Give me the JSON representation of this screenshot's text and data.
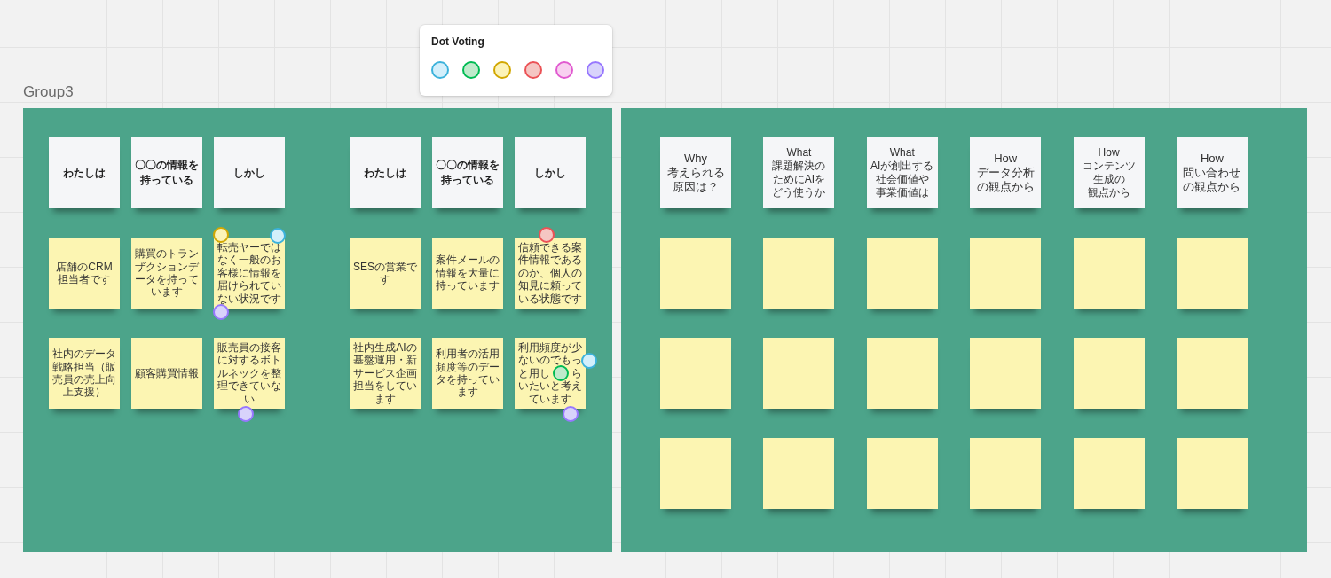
{
  "dot_voting": {
    "title": "Dot Voting",
    "dots": [
      {
        "color": "#d3effb"
      },
      {
        "color": "#bfeacb"
      },
      {
        "color": "#fcf3b8"
      },
      {
        "color": "#f5c6c3"
      },
      {
        "color": "#f8d0f0"
      },
      {
        "color": "#d8d3fb"
      }
    ]
  },
  "boards": [
    {
      "title": "Group3",
      "groups": [
        {
          "columns": [
            {
              "notes": [
                {
                  "kind": "label",
                  "text": "わたしは"
                },
                {
                  "kind": "idea",
                  "text": "店舗のCRM担当者です"
                },
                {
                  "kind": "idea",
                  "text": "社内のデータ戦略担当（販売員の売上向上支援）"
                }
              ]
            },
            {
              "notes": [
                {
                  "kind": "label",
                  "text": "〇〇の情報を持っている"
                },
                {
                  "kind": "idea",
                  "text": "購買のトランザクションデータを持っています"
                },
                {
                  "kind": "idea",
                  "text": "顧客購買情報"
                }
              ]
            },
            {
              "notes": [
                {
                  "kind": "label",
                  "text": "しかし"
                },
                {
                  "kind": "idea",
                  "text": "転売ヤーではなく一般のお客様に情報を届けられていない状況です",
                  "votes": [
                    {
                      "color": "#fcf3b8",
                      "kind": "top-left"
                    },
                    {
                      "color": "#d3effb",
                      "kind": "top-right"
                    },
                    {
                      "color": "#d8d3fb",
                      "kind": "bottom-left"
                    }
                  ]
                },
                {
                  "kind": "idea",
                  "text": "販売員の接客に対するボトルネックを整理できていない",
                  "votes": [
                    {
                      "color": "#d8d3fb",
                      "kind": "bottom"
                    }
                  ]
                }
              ]
            }
          ]
        },
        {
          "columns": [
            {
              "notes": [
                {
                  "kind": "label",
                  "text": "わたしは"
                },
                {
                  "kind": "idea",
                  "text": "SESの営業です"
                },
                {
                  "kind": "idea",
                  "text": "社内生成AIの基盤運用・新サービス企画担当をしています"
                }
              ]
            },
            {
              "notes": [
                {
                  "kind": "label",
                  "text": "〇〇の情報を持っている"
                },
                {
                  "kind": "idea",
                  "text": "案件メールの情報を大量に持っています"
                },
                {
                  "kind": "idea",
                  "text": "利用者の活用頻度等のデータを持っています"
                }
              ]
            },
            {
              "notes": [
                {
                  "kind": "label",
                  "text": "しかし"
                },
                {
                  "kind": "idea",
                  "text": "信頼できる案件情報であるのか、個人の知見に頼っている状態です",
                  "votes": [
                    {
                      "color": "#f5c6c3",
                      "kind": "top"
                    }
                  ]
                },
                {
                  "kind": "idea",
                  "text": "利用頻度が少ないのでもっと用し　　らいたいと考えています",
                  "votes": [
                    {
                      "color": "#d3effb",
                      "kind": "right"
                    },
                    {
                      "color": "#bfeacb",
                      "kind": "center"
                    },
                    {
                      "color": "#d8d3fb",
                      "kind": "bottom-right"
                    }
                  ]
                }
              ]
            }
          ]
        }
      ]
    },
    {
      "groups": [
        {
          "columns": [
            {
              "notes": [
                {
                  "kind": "question",
                  "lines": [
                    "Why",
                    "考えられる",
                    "原因は？"
                  ]
                },
                {
                  "kind": "idea"
                },
                {
                  "kind": "idea"
                },
                {
                  "kind": "idea"
                }
              ]
            },
            {
              "notes": [
                {
                  "kind": "question",
                  "lines": [
                    "What",
                    "課題解決の",
                    "ためにAIを",
                    "どう使うか"
                  ]
                },
                {
                  "kind": "idea"
                },
                {
                  "kind": "idea"
                },
                {
                  "kind": "idea"
                }
              ]
            },
            {
              "notes": [
                {
                  "kind": "question",
                  "lines": [
                    "What",
                    "AIが創出する",
                    "社会価値や",
                    "事業価値は"
                  ]
                },
                {
                  "kind": "idea"
                },
                {
                  "kind": "idea"
                },
                {
                  "kind": "idea"
                }
              ]
            },
            {
              "notes": [
                {
                  "kind": "question",
                  "lines": [
                    "How",
                    "データ分析",
                    "の観点から"
                  ]
                },
                {
                  "kind": "idea"
                },
                {
                  "kind": "idea"
                },
                {
                  "kind": "idea"
                }
              ]
            },
            {
              "notes": [
                {
                  "kind": "question",
                  "lines": [
                    "How",
                    "コンテンツ",
                    "生成の",
                    "観点から"
                  ]
                },
                {
                  "kind": "idea"
                },
                {
                  "kind": "idea"
                },
                {
                  "kind": "idea"
                }
              ]
            },
            {
              "notes": [
                {
                  "kind": "question",
                  "lines": [
                    "How",
                    "問い合わせ",
                    "の観点から"
                  ]
                },
                {
                  "kind": "idea"
                },
                {
                  "kind": "idea"
                },
                {
                  "kind": "idea"
                }
              ]
            }
          ]
        }
      ]
    }
  ]
}
